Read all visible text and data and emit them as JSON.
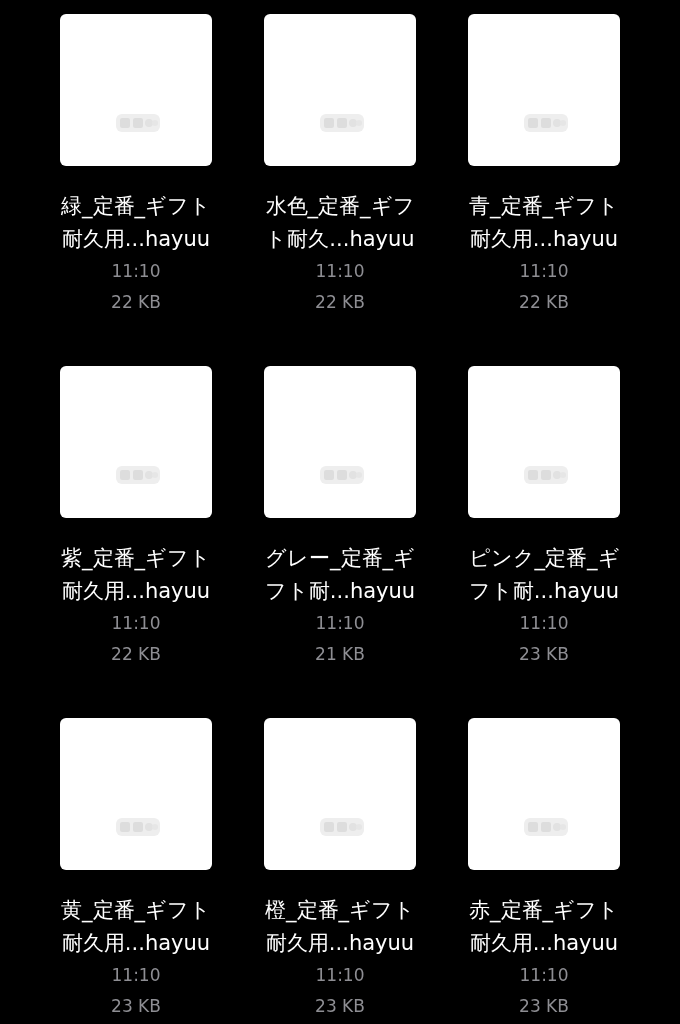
{
  "files": [
    {
      "name_lines": [
        "緑_定番_ギフト",
        "耐久用...hayuu"
      ],
      "time": "11:10",
      "size": "22 KB"
    },
    {
      "name_lines": [
        "水色_定番_ギフ",
        "ト耐久...hayuu"
      ],
      "time": "11:10",
      "size": "22 KB"
    },
    {
      "name_lines": [
        "青_定番_ギフト",
        "耐久用...hayuu"
      ],
      "time": "11:10",
      "size": "22 KB"
    },
    {
      "name_lines": [
        "紫_定番_ギフト",
        "耐久用...hayuu"
      ],
      "time": "11:10",
      "size": "22 KB"
    },
    {
      "name_lines": [
        "グレー_定番_ギ",
        "フト耐...hayuu"
      ],
      "time": "11:10",
      "size": "21 KB"
    },
    {
      "name_lines": [
        "ピンク_定番_ギ",
        "フト耐...hayuu"
      ],
      "time": "11:10",
      "size": "23 KB"
    },
    {
      "name_lines": [
        "黄_定番_ギフト",
        "耐久用...hayuu"
      ],
      "time": "11:10",
      "size": "23 KB"
    },
    {
      "name_lines": [
        "橙_定番_ギフト",
        "耐久用...hayuu"
      ],
      "time": "11:10",
      "size": "23 KB"
    },
    {
      "name_lines": [
        "赤_定番_ギフト",
        "耐久用...hayuu"
      ],
      "time": "11:10",
      "size": "23 KB"
    }
  ]
}
